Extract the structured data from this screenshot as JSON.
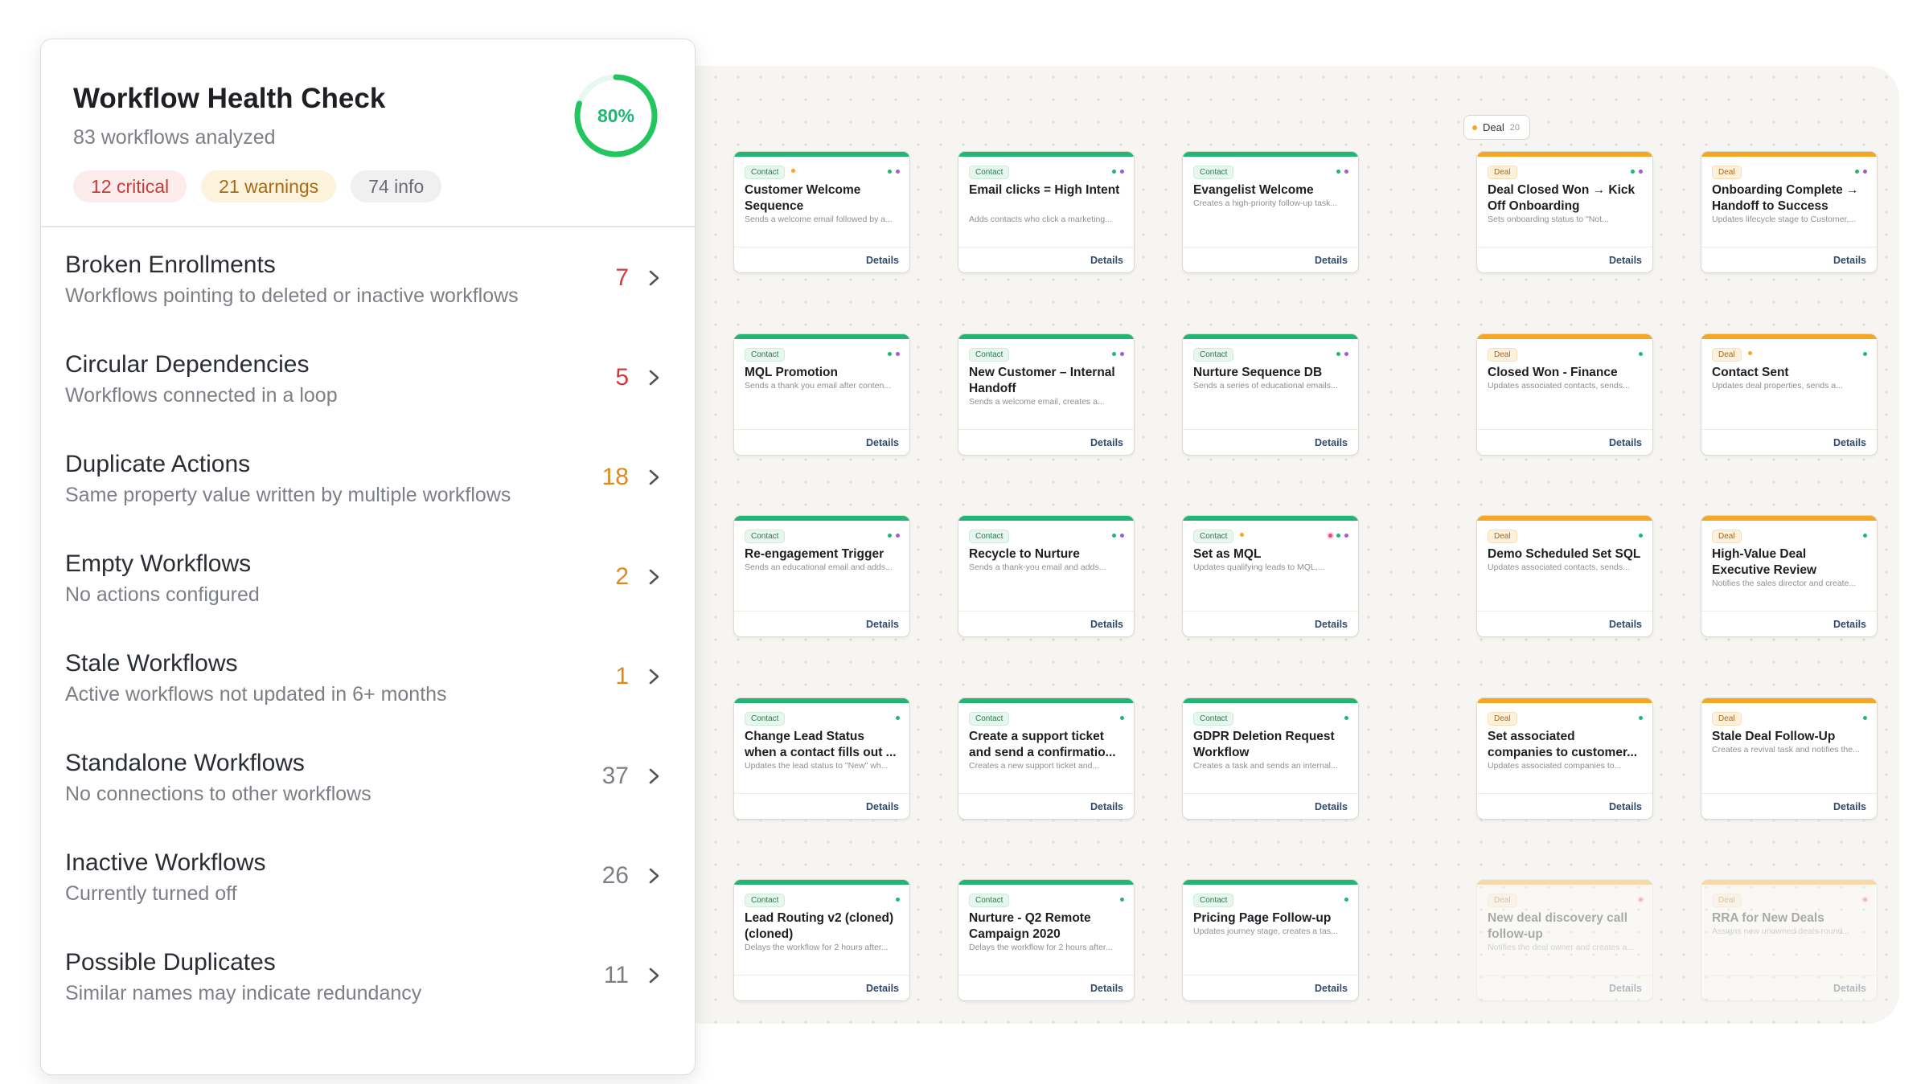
{
  "health": {
    "title": "Workflow Health Check",
    "subtitle": "83 workflows analyzed",
    "score": "80%",
    "score_value": 0.8,
    "pills": {
      "critical": "12 critical",
      "warnings": "21 warnings",
      "info": "74 info"
    },
    "rows": [
      {
        "title": "Broken Enrollments",
        "desc": "Workflows pointing to deleted or inactive workflows",
        "count": "7",
        "severity": "critical"
      },
      {
        "title": "Circular Dependencies",
        "desc": "Workflows connected in a loop",
        "count": "5",
        "severity": "critical"
      },
      {
        "title": "Duplicate Actions",
        "desc": "Same property value written by multiple workflows",
        "count": "18",
        "severity": "warning"
      },
      {
        "title": "Empty Workflows",
        "desc": "No actions configured",
        "count": "2",
        "severity": "warning"
      },
      {
        "title": "Stale Workflows",
        "desc": "Active workflows not updated in 6+ months",
        "count": "1",
        "severity": "warning"
      },
      {
        "title": "Standalone Workflows",
        "desc": "No connections to other workflows",
        "count": "37",
        "severity": "info"
      },
      {
        "title": "Inactive Workflows",
        "desc": "Currently turned off",
        "count": "26",
        "severity": "info"
      },
      {
        "title": "Possible Duplicates",
        "desc": "Similar names may indicate redundancy",
        "count": "11",
        "severity": "info"
      }
    ]
  },
  "canvas": {
    "deal_group": {
      "label": "Deal",
      "count": "20"
    },
    "details_label": "Details",
    "colors": {
      "contact": "#22b573",
      "deal": "#f5a623"
    },
    "cards": [
      {
        "type": "Contact",
        "title": "Customer Welcome Sequence",
        "desc": "Sends a welcome email followed by a...",
        "type_dot": true,
        "dots": [
          "g",
          "p"
        ]
      },
      {
        "type": "Contact",
        "title": "Email clicks = High Intent",
        "desc": "Adds contacts who click a marketing...",
        "dots": [
          "g",
          "p"
        ]
      },
      {
        "type": "Contact",
        "title": "Evangelist Welcome",
        "desc": "Creates a high-priority follow-up task...",
        "dots": [
          "g",
          "p"
        ]
      },
      {
        "type": "Deal",
        "title": "Deal Closed Won → Kick Off Onboarding",
        "desc": "Sets onboarding status to \"Not...",
        "dots": [
          "g",
          "p"
        ]
      },
      {
        "type": "Deal",
        "title": "Onboarding Complete → Handoff to Success",
        "desc": "Updates lifecycle stage to Customer,...",
        "dots": [
          "g",
          "p"
        ]
      },
      {
        "type": "Contact",
        "title": "MQL Promotion",
        "desc": "Sends a thank you email after conten...",
        "dots": [
          "g",
          "p"
        ]
      },
      {
        "type": "Contact",
        "title": "New Customer – Internal Handoff",
        "desc": "Sends a welcome email, creates a...",
        "dots": [
          "g",
          "p"
        ]
      },
      {
        "type": "Contact",
        "title": "Nurture Sequence DB",
        "desc": "Sends a series of educational emails...",
        "dots": [
          "g",
          "p"
        ]
      },
      {
        "type": "Deal",
        "title": "Closed Won - Finance",
        "desc": "Updates associated contacts, sends...",
        "dots": [
          "g"
        ]
      },
      {
        "type": "Deal",
        "title": "Contact Sent",
        "desc": "Updates deal properties, sends a...",
        "type_dot": true,
        "dots": [
          "g"
        ]
      },
      {
        "type": "Contact",
        "title": "Re-engagement Trigger",
        "desc": "Sends an educational email and adds...",
        "dots": [
          "g",
          "p"
        ]
      },
      {
        "type": "Contact",
        "title": "Recycle to Nurture",
        "desc": "Sends a thank-you email and adds...",
        "dots": [
          "g",
          "p"
        ]
      },
      {
        "type": "Contact",
        "title": "Set as MQL",
        "desc": "Updates qualifying leads to MQL,...",
        "type_dot": true,
        "dots": [
          "pink",
          "g",
          "p"
        ]
      },
      {
        "type": "Deal",
        "title": "Demo Scheduled Set SQL",
        "desc": "Updates associated contacts, sends...",
        "dots": [
          "g"
        ]
      },
      {
        "type": "Deal",
        "title": "High-Value Deal Executive Review",
        "desc": "Notifies the sales director and create...",
        "dots": [
          "g"
        ]
      },
      {
        "type": "Contact",
        "title": "Change Lead Status when a contact fills out ...",
        "desc": "Updates the lead status to \"New\" wh...",
        "dots": [
          "g"
        ]
      },
      {
        "type": "Contact",
        "title": "Create a support ticket and send a confirmatio...",
        "desc": "Creates a new support ticket and...",
        "dots": [
          "g"
        ]
      },
      {
        "type": "Contact",
        "title": "GDPR Deletion Request Workflow",
        "desc": "Creates a task and sends an internal...",
        "dots": [
          "g"
        ]
      },
      {
        "type": "Deal",
        "title": "Set associated companies to customer...",
        "desc": "Updates associated companies to...",
        "dots": [
          "g"
        ]
      },
      {
        "type": "Deal",
        "title": "Stale Deal Follow-Up",
        "desc": "Creates a revival task and notifies the...",
        "dots": [
          "g"
        ]
      },
      {
        "type": "Contact",
        "title": "Lead Routing v2 (cloned) (cloned)",
        "desc": "Delays the workflow for 2 hours after...",
        "dots": [
          "g"
        ]
      },
      {
        "type": "Contact",
        "title": "Nurture - Q2 Remote Campaign 2020",
        "desc": "Delays the workflow for 2 hours after...",
        "dots": [
          "g"
        ]
      },
      {
        "type": "Contact",
        "title": "Pricing Page Follow-up",
        "desc": "Updates journey stage, creates a tas...",
        "dots": [
          "g"
        ]
      },
      {
        "type": "Deal",
        "title": "New deal discovery call follow-up",
        "desc": "Notifies the deal owner and creates a...",
        "dots": [
          "r"
        ],
        "faded": true
      },
      {
        "type": "Deal",
        "title": "RRA for New Deals",
        "desc": "Assigns new unowned deals round...",
        "dots": [
          "r"
        ],
        "faded": true
      }
    ]
  }
}
